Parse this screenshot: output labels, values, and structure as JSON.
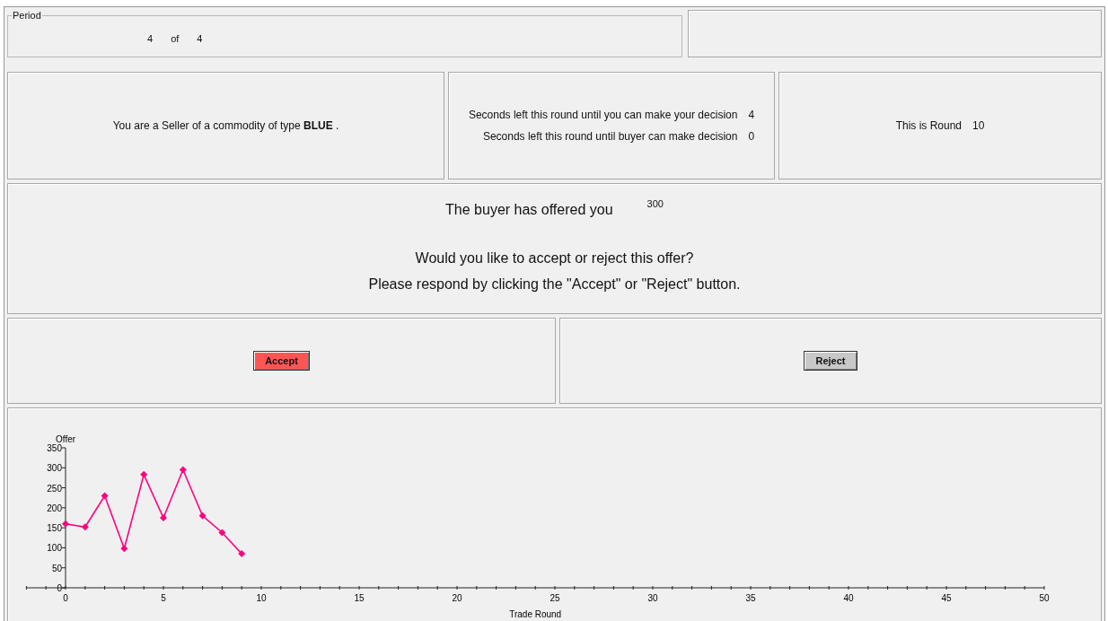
{
  "period": {
    "legend": "Period",
    "current": "4",
    "of": "of",
    "total": "4"
  },
  "role": {
    "text": "You are a Seller of a commodity of type **BLUE** ."
  },
  "timers": [
    {
      "label": "Seconds left this round until you can make your decision",
      "value": "4"
    },
    {
      "label": "Seconds left this round until buyer can make decision",
      "value": "0"
    }
  ],
  "round": {
    "label": "This is Round",
    "value": "10"
  },
  "offer": {
    "label": "The buyer has offered you",
    "amount": "300",
    "question": "Would you like to accept or reject this offer?",
    "instruction": "Please respond by clicking the \"Accept\" or \"Reject\" button."
  },
  "buttons": [
    {
      "label": "Accept",
      "color": "#ff5555"
    },
    {
      "label": "Reject",
      "color": "#c8c8c8"
    }
  ],
  "chart": {
    "chart_data": {
      "type": "line",
      "xlabel": "Trade Round",
      "ylabel": "Offer",
      "xlim": [
        -2,
        50
      ],
      "ylim": [
        0,
        350
      ],
      "xticks": [
        0,
        5,
        10,
        15,
        20,
        25,
        30,
        35,
        40,
        45,
        50
      ],
      "yticks": [
        0,
        50,
        100,
        150,
        200,
        250,
        300,
        350
      ],
      "x": [
        0,
        1,
        2,
        3,
        4,
        5,
        6,
        7,
        8,
        9
      ],
      "series": [
        {
          "color": "#ff0080",
          "marker": "diamond",
          "values": [
            160,
            152,
            230,
            98,
            283,
            175,
            295,
            180,
            138,
            85
          ]
        }
      ]
    }
  }
}
